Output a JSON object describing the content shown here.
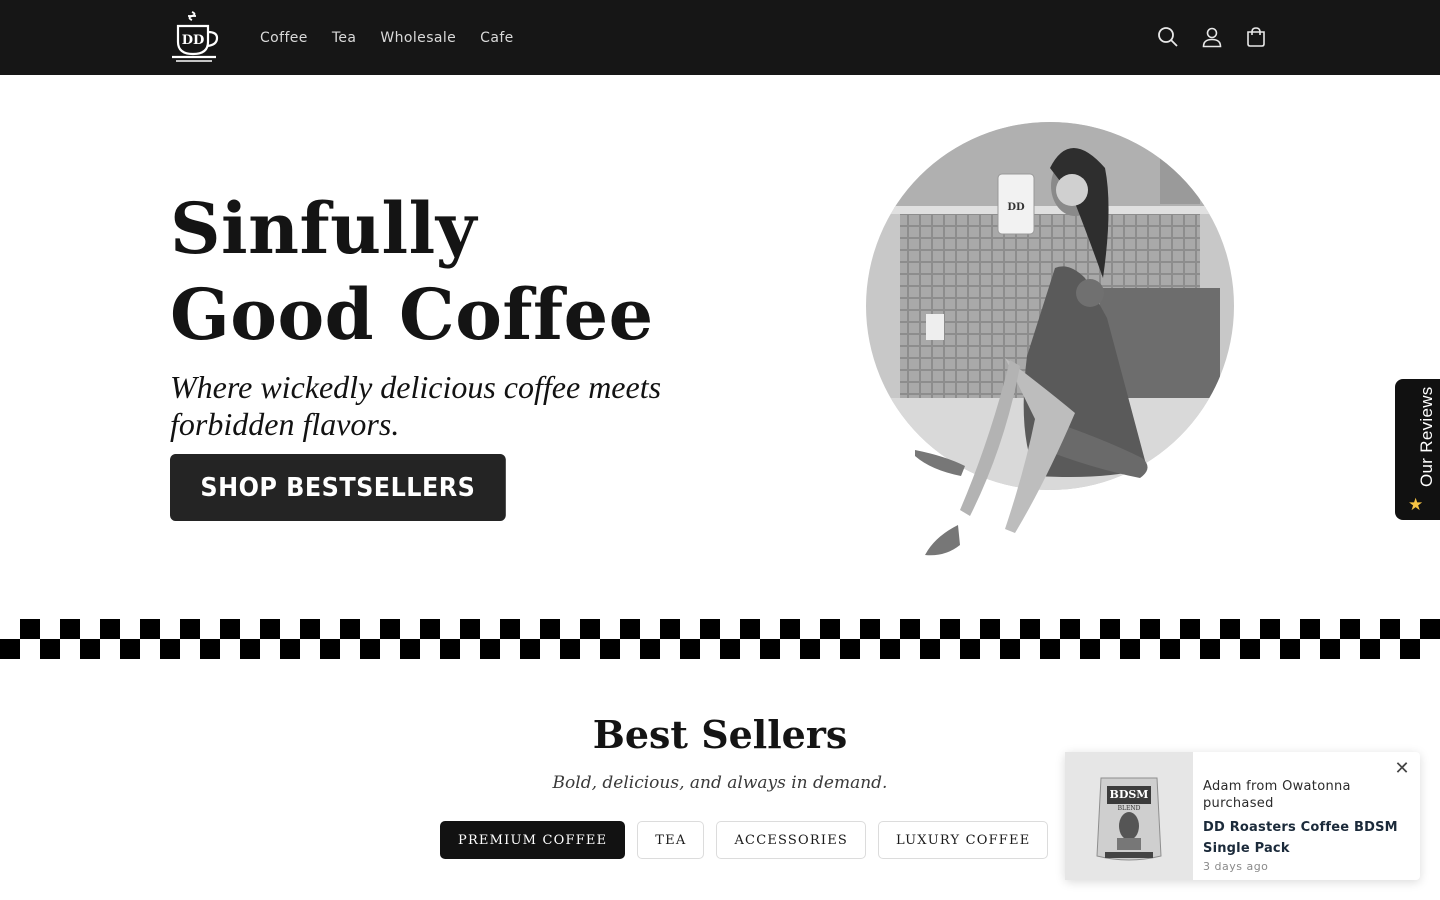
{
  "header": {
    "nav": [
      "Coffee",
      "Tea",
      "Wholesale",
      "Cafe"
    ],
    "icons": [
      "search-icon",
      "account-icon",
      "cart-icon"
    ],
    "logo_letters": "DD"
  },
  "hero": {
    "title_line1": "Sinfully",
    "title_line2": "Good Coffee",
    "subtitle": "Where wickedly delicious coffee meets forbidden flavors.",
    "button": "SHOP BESTSELLERS",
    "bag_label": "DD"
  },
  "best_sellers": {
    "title": "Best Sellers",
    "subtitle": "Bold, delicious, and always in demand.",
    "tabs": [
      "PREMIUM COFFEE",
      "TEA",
      "ACCESSORIES",
      "LUXURY COFFEE"
    ],
    "active_tab": "PREMIUM COFFEE"
  },
  "reviews_tab": {
    "label": "Our Reviews",
    "icon": "star-icon"
  },
  "popup": {
    "who": "Adam from Owatonna purchased",
    "product": "DD Roasters Coffee BDSM Single Pack",
    "time": "3 days ago",
    "bag_label": "BDSM",
    "bag_sublabel": "BLEND"
  },
  "colors": {
    "header_bg": "#161616",
    "button_bg": "#242424",
    "accent_star": "#f6c343"
  }
}
